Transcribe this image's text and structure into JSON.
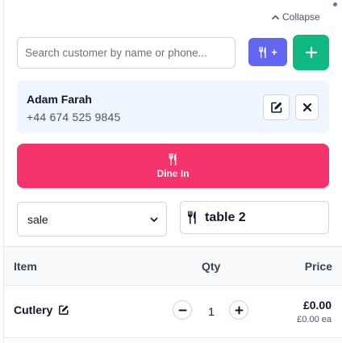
{
  "header": {
    "collapse_label": "Collapse"
  },
  "search": {
    "placeholder": "Search customer by name or phone...",
    "value": ""
  },
  "actions": {
    "dine_add_label": "+"
  },
  "customer": {
    "name": "Adam Farah",
    "phone": "+44 674 525 9845"
  },
  "order_type": {
    "label": "Dine In"
  },
  "sale_select": {
    "value": "sale"
  },
  "table": {
    "label": "table 2"
  },
  "columns": {
    "item": "Item",
    "qty": "Qty",
    "price": "Price"
  },
  "items": [
    {
      "name": "Cutlery",
      "qty": "1",
      "price": "£0.00",
      "unit_price": "£0.00 ea"
    }
  ],
  "colors": {
    "accent": "#6366f1",
    "success": "#10b981",
    "dine_in": "#f5336d",
    "card_bg": "#eff6ff"
  },
  "icons": [
    "chevron-up-icon",
    "utensils-icon",
    "plus-icon",
    "edit-icon",
    "close-icon",
    "chevron-down-icon",
    "minus-icon"
  ]
}
